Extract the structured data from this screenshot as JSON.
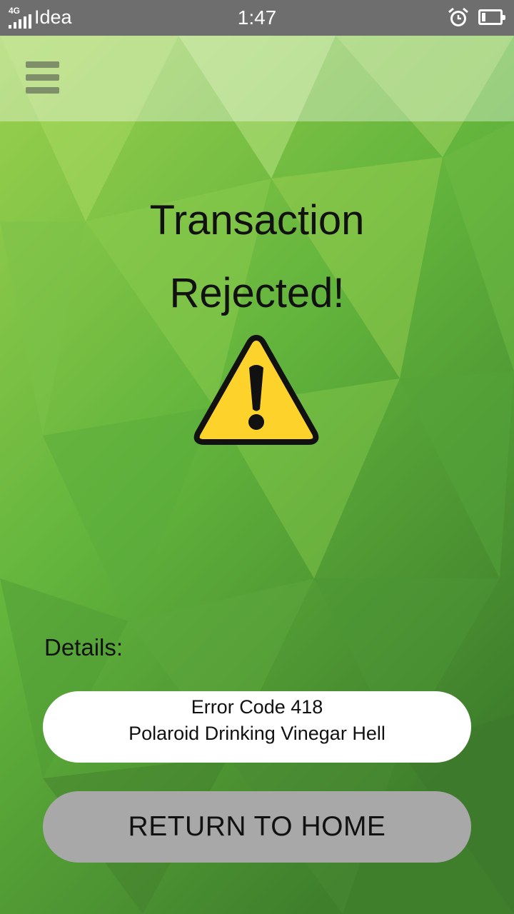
{
  "status_bar": {
    "network": "4G",
    "carrier": "Idea",
    "time": "1:47",
    "battery_level": 0.2,
    "icons": [
      "signal-icon",
      "alarm-icon",
      "battery-icon"
    ]
  },
  "app_bar": {
    "menu_icon": "hamburger-menu-icon"
  },
  "main": {
    "title_line1": "Transaction",
    "title_line2": "Rejected!",
    "status_icon": "warning-icon",
    "details_label": "Details:",
    "error_code": "Error Code 418",
    "error_message": "Polaroid Drinking Vinegar Hell",
    "return_button_label": "RETURN TO HOME"
  },
  "colors": {
    "background": "#5aa83a",
    "status_bar": "#6e6e6e",
    "warning_fill": "#fdd22a",
    "button": "#a8a8a8"
  }
}
